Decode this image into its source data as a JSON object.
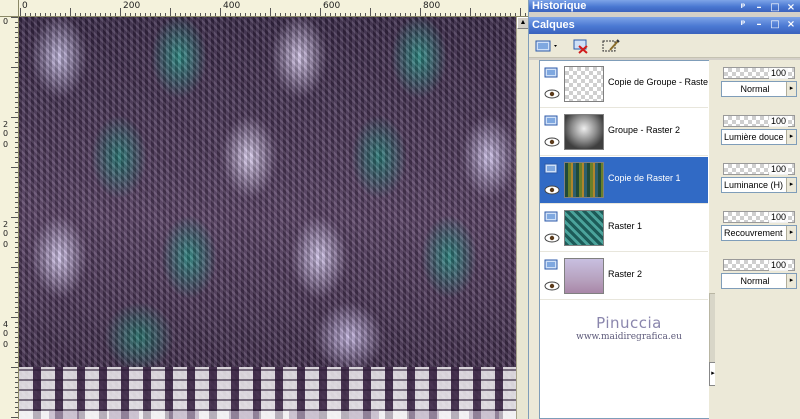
{
  "rulers": {
    "top_labels": [
      "0",
      "200",
      "400",
      "600",
      "800"
    ],
    "left_labels": [
      "0",
      "2",
      "0",
      "0",
      "2",
      "0",
      "0",
      "4",
      "0",
      "0",
      "6",
      "0",
      "0"
    ]
  },
  "history_panel": {
    "title": "Historique"
  },
  "layers_panel": {
    "title": "Calques",
    "layers": [
      {
        "name": "Copie de Groupe - Raster",
        "opacity": "100",
        "blend_mode": "Normal",
        "selected": false,
        "thumb": "transparent"
      },
      {
        "name": "Groupe - Raster 2",
        "opacity": "100",
        "blend_mode": "Lumière douce",
        "selected": false,
        "thumb": "gray"
      },
      {
        "name": "Copie de Raster 1",
        "opacity": "100",
        "blend_mode": "Luminance (H)",
        "selected": true,
        "thumb": "colorful"
      },
      {
        "name": "Raster 1",
        "opacity": "100",
        "blend_mode": "Recouvrement",
        "selected": false,
        "thumb": "teal"
      },
      {
        "name": "Raster 2",
        "opacity": "100",
        "blend_mode": "Normal",
        "selected": false,
        "thumb": "gradient"
      }
    ]
  },
  "watermark": {
    "line1": "Pinuccia",
    "line2": "www.maidiregrafica.eu"
  },
  "colors": {
    "title_blue": "#4a78d2",
    "selection": "#316ac5",
    "panel_bg": "#ece9d8"
  }
}
